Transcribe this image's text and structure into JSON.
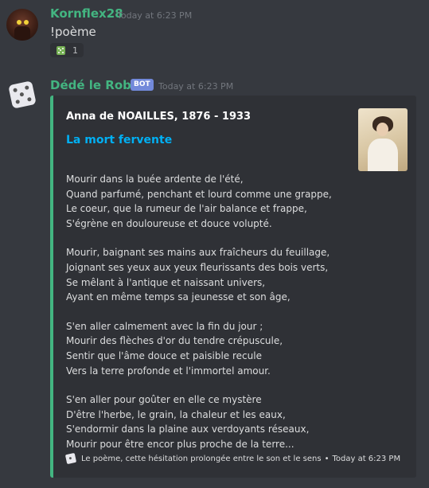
{
  "message1": {
    "username": "Kornflex28",
    "timestamp": "Today at 6:23 PM",
    "content": "!poème",
    "reaction": {
      "emoji": "game-die-emoji",
      "count": "1"
    }
  },
  "message2": {
    "username": "Dédé le Robot",
    "bot_tag": "BOT",
    "timestamp": "Today at 6:23 PM",
    "embed": {
      "accent_color": "#43b581",
      "author": "Anna de NOAILLES, 1876 - 1933",
      "title": "La mort fervente",
      "stanzas": [
        [
          "Mourir dans la buée ardente de l'été,",
          "Quand parfumé, penchant et lourd comme une grappe,",
          "Le coeur, que la rumeur de l'air balance et frappe,",
          "S'égrène en douloureuse et douce volupté."
        ],
        [
          "Mourir, baignant ses mains aux fraîcheurs du feuillage,",
          "Joignant ses yeux aux yeux fleurissants des bois verts,",
          "Se mêlant à l'antique et naissant univers,",
          "Ayant en même temps sa jeunesse et son âge,"
        ],
        [
          "S'en aller calmement avec la fin du jour ;",
          "Mourir des flèches d'or du tendre crépuscule,",
          "Sentir que l'âme douce et paisible recule",
          "Vers la terre profonde et l'immortel amour."
        ],
        [
          "S'en aller pour goûter en elle ce mystère",
          "D'être l'herbe, le grain, la chaleur et les eaux,",
          "S'endormir dans la plaine aux verdoyants réseaux,",
          "Mourir pour être encor plus proche de la terre..."
        ]
      ],
      "footer_text": "Le poème, cette hésitation prolongée entre le son et le sens",
      "footer_separator": "•",
      "footer_timestamp": "Today at 6:23 PM"
    }
  },
  "colors": {
    "background": "#36393f",
    "embed_background": "#2f3136",
    "username": "#43b581",
    "link_title": "#00b0f4",
    "bot_tag": "#7289da"
  }
}
